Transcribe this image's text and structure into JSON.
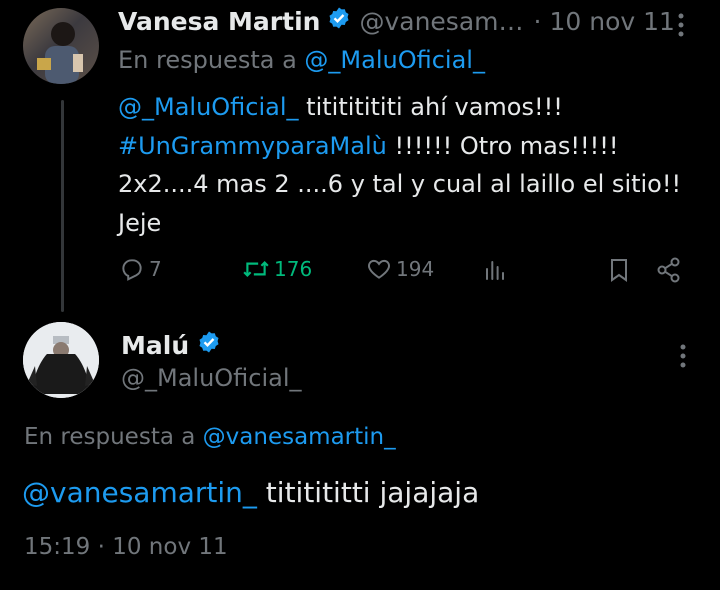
{
  "tweet1": {
    "author_name": "Vanesa Martin",
    "handle": "@vanesam…",
    "separator": "·",
    "date": "10 nov 11",
    "reply_prefix": "En respuesta a",
    "reply_to": "@_MaluOficial_",
    "body": {
      "mention": "@_MaluOficial_",
      "line1_rest": " titititititi ahí vamos!!!",
      "hashtag": "#UnGrammyparaMalù",
      "line2_rest": " !!!!!! Otro mas!!!!!",
      "line3": "2x2....4 mas 2 ....6 y tal y cual al laillo el sitio!!",
      "line4": "Jeje"
    },
    "actions": {
      "replies": "7",
      "retweets": "176",
      "likes": "194"
    }
  },
  "tweet2": {
    "author_name": "Malú",
    "handle": "@_MaluOficial_",
    "reply_prefix": "En respuesta a",
    "reply_to": "@vanesamartin_",
    "body_mention": "@vanesamartin_",
    "body_rest": " tititititti jajajaja",
    "time": "15:19",
    "separator": "·",
    "date": "10 nov 11"
  },
  "colors": {
    "background": "#000000",
    "text": "#e7e9ea",
    "muted": "#71767b",
    "link": "#1d9bf0",
    "retweet_active": "#00ba7c"
  }
}
